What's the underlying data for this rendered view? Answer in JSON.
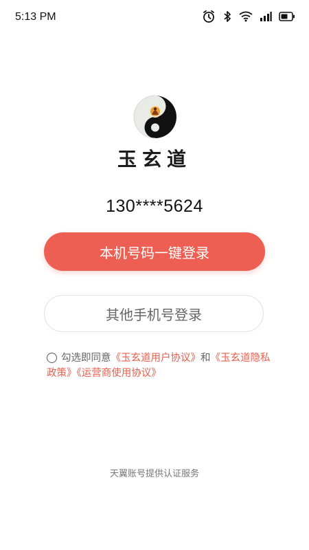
{
  "status_bar": {
    "time": "5:13 PM",
    "icons": [
      "alarm-icon",
      "bluetooth-icon",
      "wifi-icon",
      "signal-icon",
      "battery-icon"
    ]
  },
  "app": {
    "name": "玉玄道",
    "logo": "yin-yang-logo"
  },
  "login": {
    "masked_phone": "130****5624",
    "one_click_label": "本机号码一键登录",
    "other_phone_label": "其他手机号登录"
  },
  "agreement": {
    "prefix": "勾选即同意",
    "user_agreement": "《玉玄道用户协议》",
    "and": "和",
    "privacy_policy": "《玉玄道隐私政策》",
    "operator_agreement": "《运营商使用协议》"
  },
  "footer": {
    "note": "天翼账号提供认证服务"
  },
  "colors": {
    "accent": "#ed5f52",
    "link": "#e8604f"
  }
}
